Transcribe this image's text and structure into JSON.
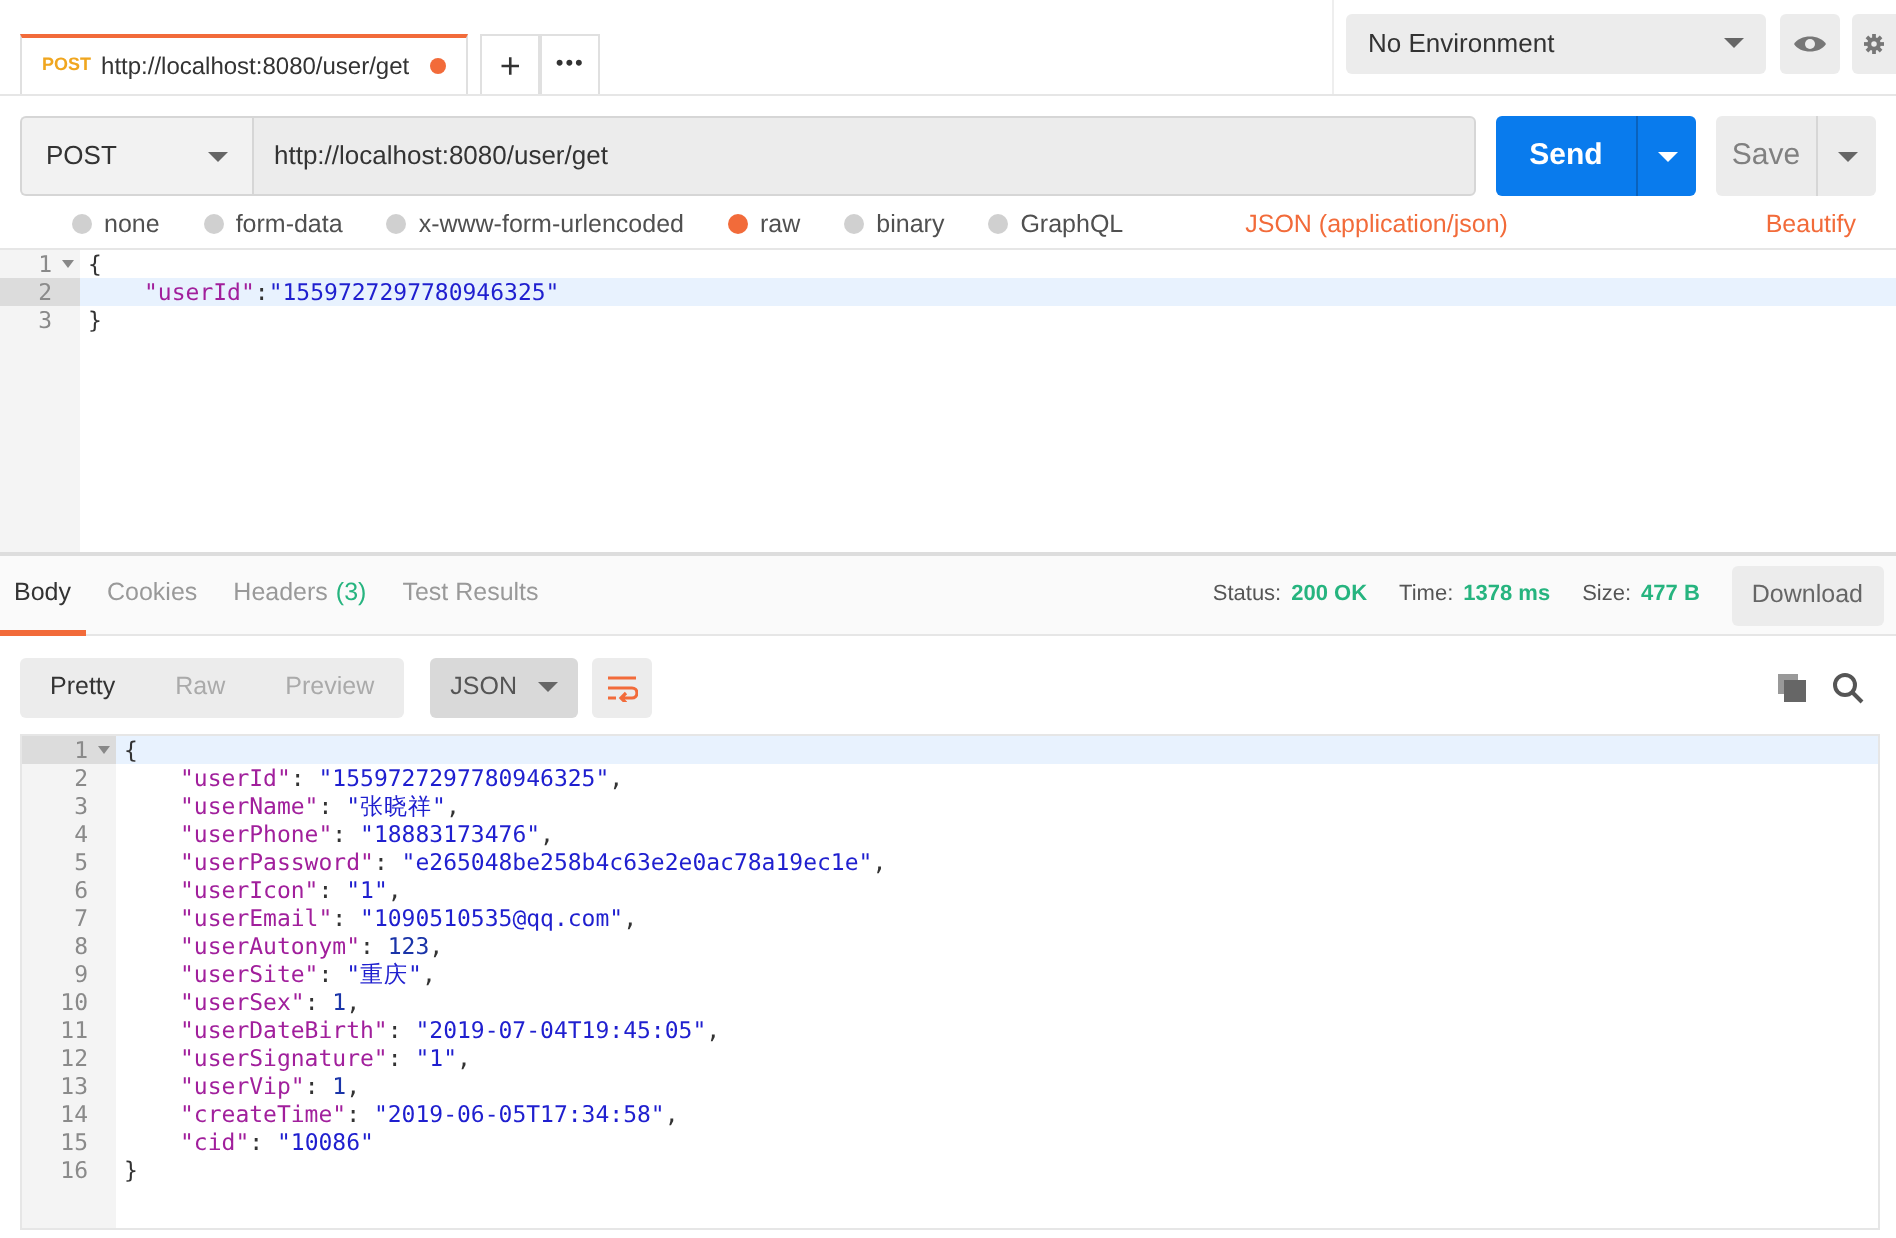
{
  "request_tabs": [
    {
      "method": "POST",
      "url": "http://localhost:8080/user/get",
      "selected": true,
      "unsaved": true
    }
  ],
  "tab_actions": [
    "+",
    "•••"
  ],
  "environment": {
    "label": "No Environment"
  },
  "request": {
    "method": "POST",
    "url": "http://localhost:8080/user/get",
    "send": "Send",
    "save": "Save"
  },
  "body_options": [
    {
      "label": "none",
      "selected": false
    },
    {
      "label": "form-data",
      "selected": false
    },
    {
      "label": "x-www-form-urlencoded",
      "selected": false
    },
    {
      "label": "raw",
      "selected": true
    },
    {
      "label": "binary",
      "selected": false
    },
    {
      "label": "GraphQL",
      "selected": false
    }
  ],
  "body_format": "JSON (application/json)",
  "beautify": "Beautify",
  "request_editor": {
    "lines": [
      {
        "number": "1",
        "foldable": true,
        "active": false,
        "indented": false,
        "parts": [
          {
            "kind": "punct",
            "text": "{"
          }
        ]
      },
      {
        "number": "2",
        "foldable": false,
        "active": true,
        "indented": true,
        "parts": [
          {
            "kind": "key",
            "text": "\"userId\""
          },
          {
            "kind": "punct",
            "text": ":"
          },
          {
            "kind": "string",
            "text": "\"1559727297780946325\""
          }
        ]
      },
      {
        "number": "3",
        "foldable": false,
        "active": false,
        "indented": false,
        "parts": [
          {
            "kind": "punct",
            "text": "}"
          }
        ]
      }
    ]
  },
  "response_tabs": [
    {
      "label": "Body",
      "selected": true
    },
    {
      "label": "Cookies",
      "selected": false
    },
    {
      "label": "Headers",
      "count": "(3)",
      "selected": false
    },
    {
      "label": "Test Results",
      "selected": false
    }
  ],
  "response_meta": [
    {
      "label": "Status:",
      "value": "200 OK"
    },
    {
      "label": "Time:",
      "value": "1378 ms"
    },
    {
      "label": "Size:",
      "value": "477 B"
    }
  ],
  "download": "Download",
  "view_modes": [
    {
      "label": "Pretty",
      "selected": true
    },
    {
      "label": "Raw",
      "selected": false
    },
    {
      "label": "Preview",
      "selected": false
    }
  ],
  "format": "JSON",
  "response_editor": {
    "lines": [
      {
        "number": "1",
        "foldable": true,
        "active": true,
        "indented": false,
        "parts": [
          {
            "kind": "punct",
            "text": "{"
          }
        ]
      },
      {
        "number": "2",
        "foldable": false,
        "active": false,
        "indented": true,
        "parts": [
          {
            "kind": "key",
            "text": "\"userId\""
          },
          {
            "kind": "punct",
            "text": ": "
          },
          {
            "kind": "string",
            "text": "\"1559727297780946325\""
          },
          {
            "kind": "punct",
            "text": ","
          }
        ]
      },
      {
        "number": "3",
        "foldable": false,
        "active": false,
        "indented": true,
        "parts": [
          {
            "kind": "key",
            "text": "\"userName\""
          },
          {
            "kind": "punct",
            "text": ": "
          },
          {
            "kind": "string",
            "text": "\"张晓祥\""
          },
          {
            "kind": "punct",
            "text": ","
          }
        ]
      },
      {
        "number": "4",
        "foldable": false,
        "active": false,
        "indented": true,
        "parts": [
          {
            "kind": "key",
            "text": "\"userPhone\""
          },
          {
            "kind": "punct",
            "text": ": "
          },
          {
            "kind": "string",
            "text": "\"18883173476\""
          },
          {
            "kind": "punct",
            "text": ","
          }
        ]
      },
      {
        "number": "5",
        "foldable": false,
        "active": false,
        "indented": true,
        "parts": [
          {
            "kind": "key",
            "text": "\"userPassword\""
          },
          {
            "kind": "punct",
            "text": ": "
          },
          {
            "kind": "string",
            "text": "\"e265048be258b4c63e2e0ac78a19ec1e\""
          },
          {
            "kind": "punct",
            "text": ","
          }
        ]
      },
      {
        "number": "6",
        "foldable": false,
        "active": false,
        "indented": true,
        "parts": [
          {
            "kind": "key",
            "text": "\"userIcon\""
          },
          {
            "kind": "punct",
            "text": ": "
          },
          {
            "kind": "string",
            "text": "\"1\""
          },
          {
            "kind": "punct",
            "text": ","
          }
        ]
      },
      {
        "number": "7",
        "foldable": false,
        "active": false,
        "indented": true,
        "parts": [
          {
            "kind": "key",
            "text": "\"userEmail\""
          },
          {
            "kind": "punct",
            "text": ": "
          },
          {
            "kind": "string",
            "text": "\"1090510535@qq.com\""
          },
          {
            "kind": "punct",
            "text": ","
          }
        ]
      },
      {
        "number": "8",
        "foldable": false,
        "active": false,
        "indented": true,
        "parts": [
          {
            "kind": "key",
            "text": "\"userAutonym\""
          },
          {
            "kind": "punct",
            "text": ": "
          },
          {
            "kind": "number",
            "text": "123"
          },
          {
            "kind": "punct",
            "text": ","
          }
        ]
      },
      {
        "number": "9",
        "foldable": false,
        "active": false,
        "indented": true,
        "parts": [
          {
            "kind": "key",
            "text": "\"userSite\""
          },
          {
            "kind": "punct",
            "text": ": "
          },
          {
            "kind": "string",
            "text": "\"重庆\""
          },
          {
            "kind": "punct",
            "text": ","
          }
        ]
      },
      {
        "number": "10",
        "foldable": false,
        "active": false,
        "indented": true,
        "parts": [
          {
            "kind": "key",
            "text": "\"userSex\""
          },
          {
            "kind": "punct",
            "text": ": "
          },
          {
            "kind": "number",
            "text": "1"
          },
          {
            "kind": "punct",
            "text": ","
          }
        ]
      },
      {
        "number": "11",
        "foldable": false,
        "active": false,
        "indented": true,
        "parts": [
          {
            "kind": "key",
            "text": "\"userDateBirth\""
          },
          {
            "kind": "punct",
            "text": ": "
          },
          {
            "kind": "string",
            "text": "\"2019-07-04T19:45:05\""
          },
          {
            "kind": "punct",
            "text": ","
          }
        ]
      },
      {
        "number": "12",
        "foldable": false,
        "active": false,
        "indented": true,
        "parts": [
          {
            "kind": "key",
            "text": "\"userSignature\""
          },
          {
            "kind": "punct",
            "text": ": "
          },
          {
            "kind": "string",
            "text": "\"1\""
          },
          {
            "kind": "punct",
            "text": ","
          }
        ]
      },
      {
        "number": "13",
        "foldable": false,
        "active": false,
        "indented": true,
        "parts": [
          {
            "kind": "key",
            "text": "\"userVip\""
          },
          {
            "kind": "punct",
            "text": ": "
          },
          {
            "kind": "number",
            "text": "1"
          },
          {
            "kind": "punct",
            "text": ","
          }
        ]
      },
      {
        "number": "14",
        "foldable": false,
        "active": false,
        "indented": true,
        "parts": [
          {
            "kind": "key",
            "text": "\"createTime\""
          },
          {
            "kind": "punct",
            "text": ": "
          },
          {
            "kind": "string",
            "text": "\"2019-06-05T17:34:58\""
          },
          {
            "kind": "punct",
            "text": ","
          }
        ]
      },
      {
        "number": "15",
        "foldable": false,
        "active": false,
        "indented": true,
        "parts": [
          {
            "kind": "key",
            "text": "\"cid\""
          },
          {
            "kind": "punct",
            "text": ": "
          },
          {
            "kind": "string",
            "text": "\"10086\""
          }
        ]
      },
      {
        "number": "16",
        "foldable": false,
        "active": false,
        "indented": false,
        "parts": [
          {
            "kind": "punct",
            "text": "}"
          }
        ]
      }
    ]
  }
}
